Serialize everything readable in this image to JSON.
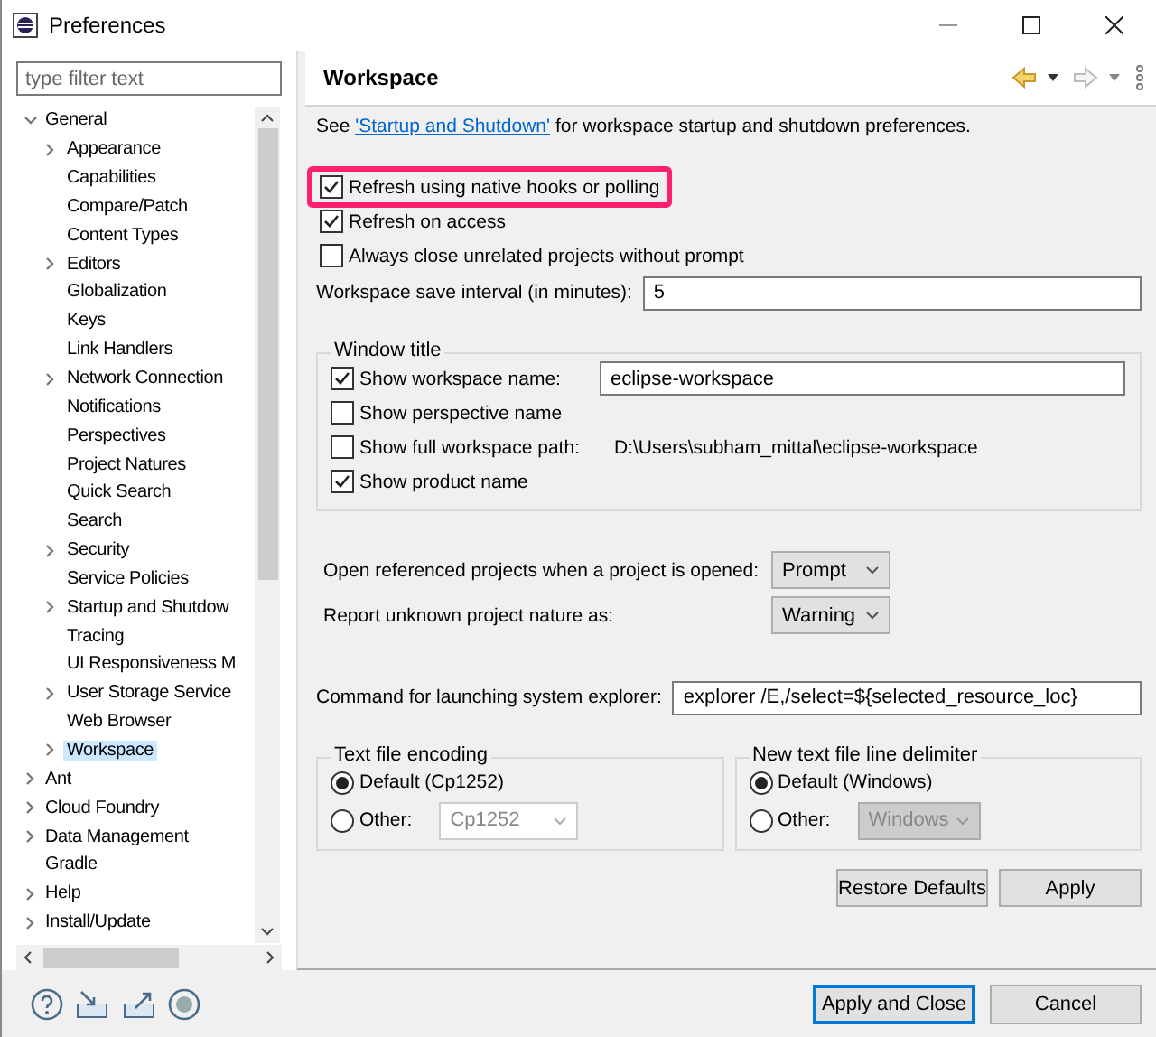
{
  "window": {
    "title": "Preferences"
  },
  "filter": {
    "placeholder": "type filter text"
  },
  "tree": [
    {
      "label": "General",
      "expanded": true,
      "selected": false,
      "children": [
        {
          "label": "Appearance",
          "expanded": false,
          "selected": false
        },
        {
          "label": "Capabilities",
          "selected": false
        },
        {
          "label": "Compare/Patch",
          "selected": false
        },
        {
          "label": "Content Types",
          "selected": false
        },
        {
          "label": "Editors",
          "expanded": false,
          "selected": false
        },
        {
          "label": "Globalization",
          "selected": false
        },
        {
          "label": "Keys",
          "selected": false
        },
        {
          "label": "Link Handlers",
          "selected": false
        },
        {
          "label": "Network Connection",
          "expanded": false,
          "selected": false
        },
        {
          "label": "Notifications",
          "selected": false
        },
        {
          "label": "Perspectives",
          "selected": false
        },
        {
          "label": "Project Natures",
          "selected": false
        },
        {
          "label": "Quick Search",
          "selected": false
        },
        {
          "label": "Search",
          "selected": false
        },
        {
          "label": "Security",
          "expanded": false,
          "selected": false
        },
        {
          "label": "Service Policies",
          "selected": false
        },
        {
          "label": "Startup and Shutdow",
          "expanded": false,
          "selected": false
        },
        {
          "label": "Tracing",
          "selected": false
        },
        {
          "label": "UI Responsiveness M",
          "selected": false
        },
        {
          "label": "User Storage Service",
          "expanded": false,
          "selected": false
        },
        {
          "label": "Web Browser",
          "selected": false
        },
        {
          "label": "Workspace",
          "expanded": false,
          "selected": true
        }
      ]
    },
    {
      "label": "Ant",
      "expanded": false,
      "selected": false
    },
    {
      "label": "Cloud Foundry",
      "expanded": false,
      "selected": false
    },
    {
      "label": "Data Management",
      "expanded": false,
      "selected": false
    },
    {
      "label": "Gradle",
      "selected": false
    },
    {
      "label": "Help",
      "expanded": false,
      "selected": false
    },
    {
      "label": "Install/Update",
      "expanded": false,
      "selected": false
    }
  ],
  "page": {
    "title": "Workspace",
    "intro": {
      "before": "See ",
      "link": "'Startup and Shutdown'",
      "after": " for workspace startup and shutdown preferences."
    },
    "options": [
      {
        "label": "Refresh using native hooks or polling",
        "checked": true,
        "highlighted": true
      },
      {
        "label": "Refresh on access",
        "checked": true,
        "highlighted": false
      },
      {
        "label": "Always close unrelated projects without prompt",
        "checked": false,
        "highlighted": false
      }
    ],
    "save_interval": {
      "label": "Workspace save interval (in minutes):",
      "value": "5"
    },
    "window_title": {
      "title": "Window title",
      "rows": [
        {
          "kind": "field",
          "label": "Show workspace name:",
          "checked": true,
          "value": "eclipse-workspace"
        },
        {
          "kind": "plain",
          "label": "Show perspective name",
          "checked": false
        },
        {
          "kind": "path",
          "label": "Show full workspace path:",
          "checked": false,
          "path": "D:\\Users\\subham_mittal\\eclipse-workspace"
        },
        {
          "kind": "plain",
          "label": "Show product name",
          "checked": true
        }
      ]
    },
    "selects": [
      {
        "label": "Open referenced projects when a project is opened:",
        "value": "Prompt"
      },
      {
        "label": "Report unknown project nature as:",
        "value": "Warning"
      }
    ],
    "explorer": {
      "label": "Command for launching system explorer:",
      "value": "explorer /E,/select=${selected_resource_loc}"
    },
    "groups": [
      {
        "title": "Text file encoding",
        "options": [
          {
            "label": "Default (Cp1252)",
            "selected": true
          },
          {
            "label": "Other:",
            "selected": false,
            "value": "Cp1252",
            "editable": true
          }
        ]
      },
      {
        "title": "New text file line delimiter",
        "options": [
          {
            "label": "Default (Windows)",
            "selected": true
          },
          {
            "label": "Other:",
            "selected": false,
            "value": "Windows",
            "editable": false
          }
        ]
      }
    ],
    "buttons": [
      "Restore Defaults",
      "Apply"
    ]
  },
  "dialog_buttons": [
    {
      "label": "Apply and Close",
      "default": true
    },
    {
      "label": "Cancel",
      "default": false
    }
  ]
}
